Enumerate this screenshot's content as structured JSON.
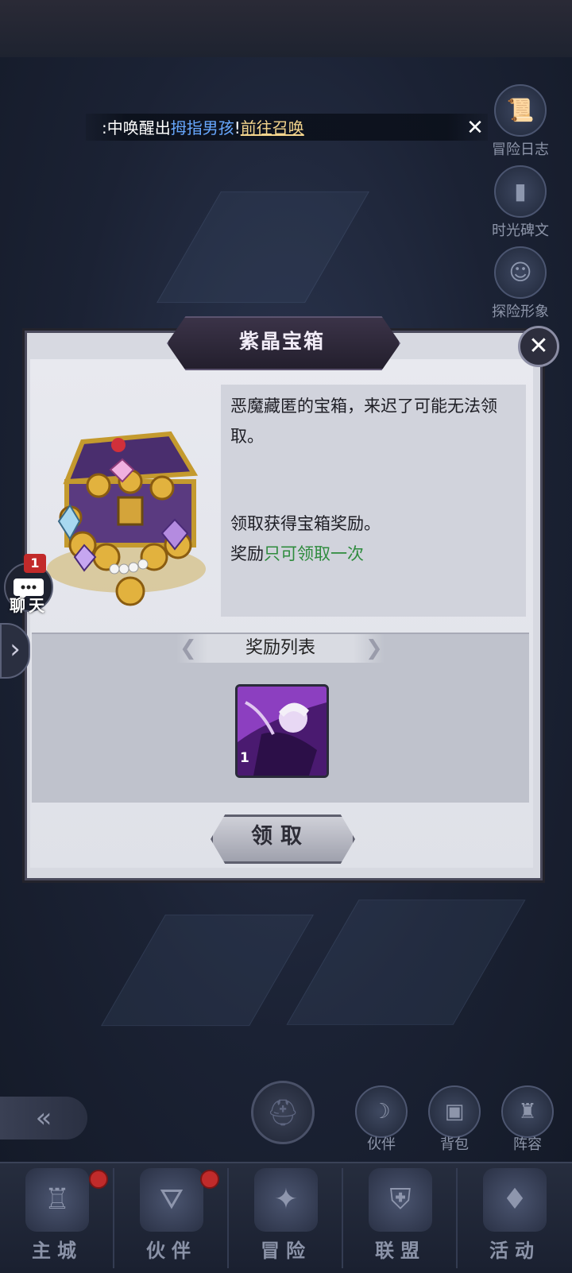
{
  "marquee": {
    "prefix": ":中唤醒出",
    "hero": "拇指男孩",
    "sep": "!",
    "link": "前往召唤",
    "close_icon": "close-icon"
  },
  "side_buttons": [
    {
      "label": "冒险日志",
      "icon": "scroll-icon"
    },
    {
      "label": "时光碑文",
      "icon": "tombstone-icon"
    },
    {
      "label": "探险形象",
      "icon": "portrait-icon"
    }
  ],
  "dialog": {
    "title": "紫晶宝箱",
    "desc_1": "恶魔藏匿的宝箱，来迟了可能无法领取。",
    "desc_2": "领取获得宝箱奖励。",
    "desc_3_prefix": "奖励",
    "desc_3_highlight": "只可领取一次",
    "reward_list_title": "奖励列表",
    "reward_count": "1",
    "claim_label": "领取"
  },
  "chat": {
    "badge": "1",
    "label": "聊天"
  },
  "bottom_buttons": [
    {
      "label": "伙伴",
      "icon": "companion-icon"
    },
    {
      "label": "背包",
      "icon": "backpack-icon"
    },
    {
      "label": "阵容",
      "icon": "chess-icon"
    }
  ],
  "nav": [
    {
      "label": "主城",
      "icon": "castle-icon"
    },
    {
      "label": "伙伴",
      "icon": "witch-hat-icon"
    },
    {
      "label": "冒险",
      "icon": "compass-icon"
    },
    {
      "label": "联盟",
      "icon": "shield-icon"
    },
    {
      "label": "活动",
      "icon": "cards-icon"
    }
  ],
  "colors": {
    "highlight_green": "#2e8b3d",
    "link_blue": "#68a8ff",
    "badge_red": "#c02b2b"
  }
}
